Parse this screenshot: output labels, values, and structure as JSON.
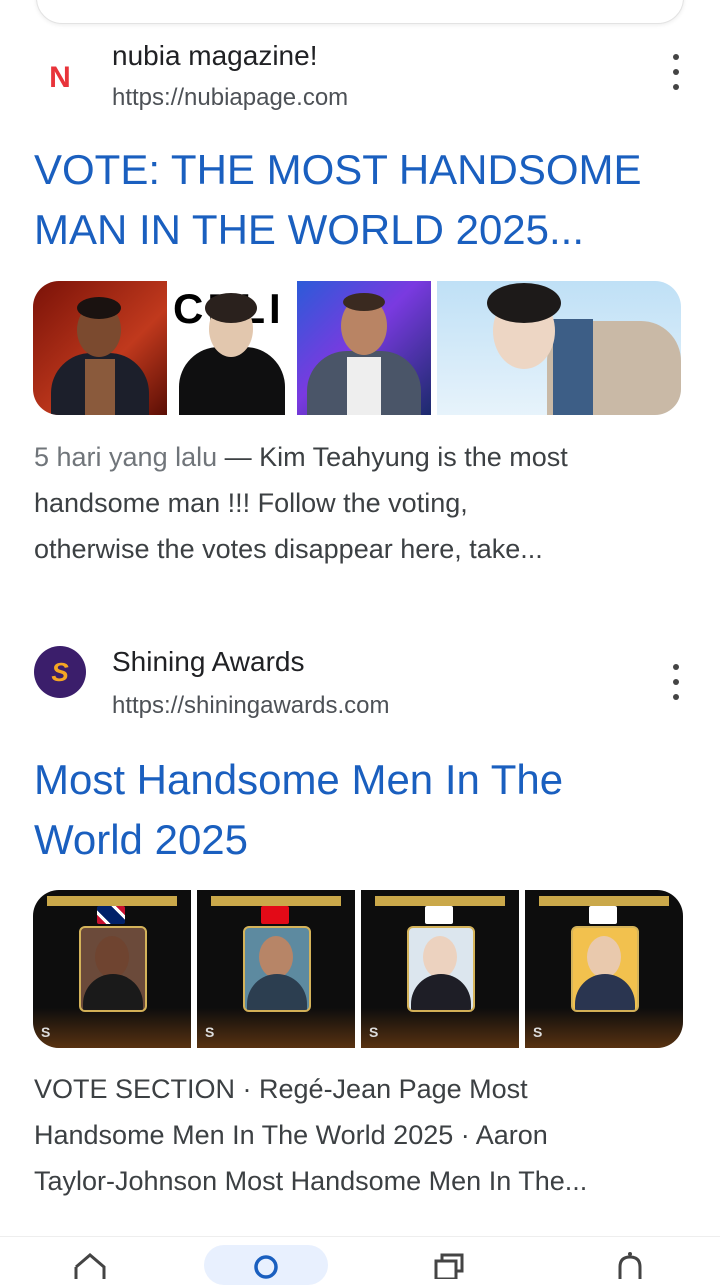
{
  "results": [
    {
      "site_name": "nubia magazine!",
      "url": "https://nubiapage.com",
      "favicon_letter": "N",
      "title_line1": "VOTE: THE MOST HANDSOME",
      "title_line2": "MAN IN THE WORLD 2025...",
      "snippet_date": "5 hari yang lalu",
      "snippet_line1_rest": " — Kim Teahyung is the most",
      "snippet_line2": "handsome man !!! Follow the voting,",
      "snippet_line3": "otherwise the votes disappear here, take..."
    },
    {
      "site_name": "Shining Awards",
      "url": "https://shiningawards.com",
      "favicon_letter": "S",
      "title_line1": "Most Handsome Men In The",
      "title_line2": "World 2025",
      "snippet_line1": "VOTE SECTION · Regé-Jean Page Most",
      "snippet_line2": "Handsome Men In The World 2025 · Aaron",
      "snippet_line3": "Taylor-Johnson Most Handsome Men In The..."
    }
  ],
  "nav": {
    "items": [
      "home-icon",
      "search-icon",
      "tabs-icon",
      "notifications-icon"
    ]
  },
  "colors": {
    "link": "#1a5fbf",
    "nubia_red": "#e8333a",
    "shining_purple": "#3b1e6b"
  }
}
